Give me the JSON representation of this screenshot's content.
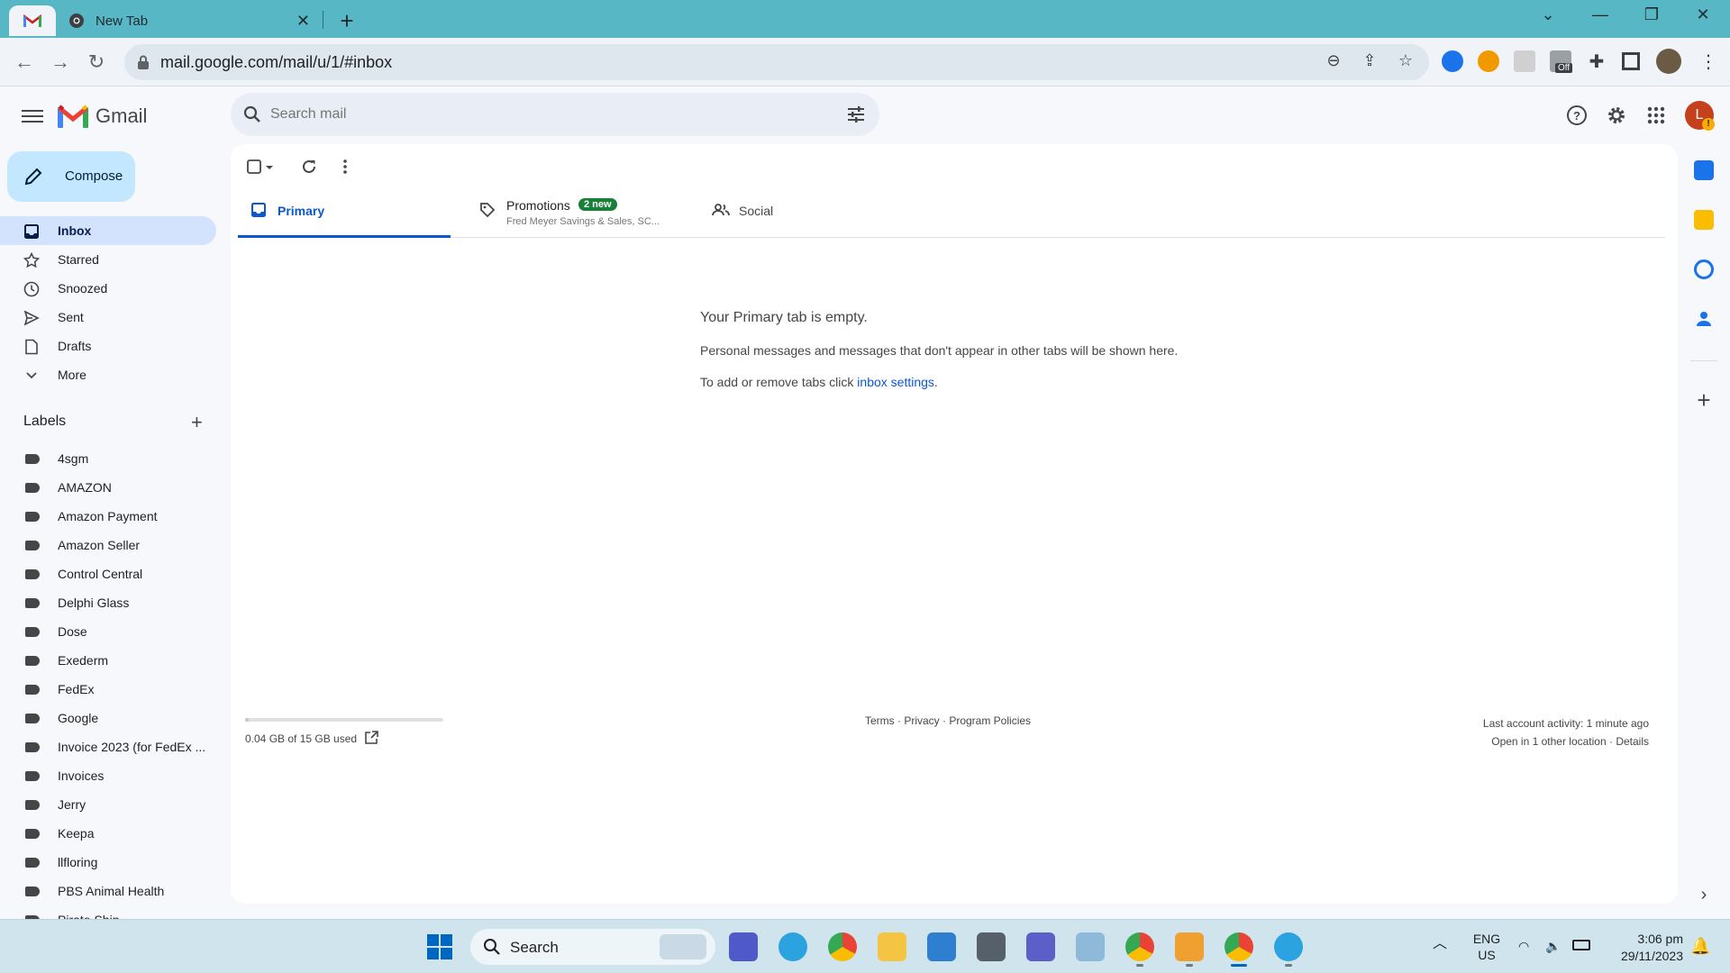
{
  "browser": {
    "tab_title": "New Tab",
    "url": "mail.google.com/mail/u/1/#inbox",
    "extension_badge": "Off"
  },
  "gmail": {
    "app_name": "Gmail",
    "search_placeholder": "Search mail",
    "avatar_letter": "L",
    "avatar_badge": "!"
  },
  "compose_label": "Compose",
  "nav": [
    {
      "label": "Inbox",
      "icon": "inbox-icon",
      "active": true
    },
    {
      "label": "Starred",
      "icon": "star-icon"
    },
    {
      "label": "Snoozed",
      "icon": "clock-icon"
    },
    {
      "label": "Sent",
      "icon": "send-icon"
    },
    {
      "label": "Drafts",
      "icon": "draft-icon"
    },
    {
      "label": "More",
      "icon": "chevron-down-icon"
    }
  ],
  "labels_heading": "Labels",
  "labels": [
    "4sgm",
    "AMAZON",
    "Amazon Payment",
    "Amazon Seller",
    "Control Central",
    "Delphi Glass",
    "Dose",
    "Exederm",
    "FedEx",
    "Google",
    "Invoice 2023 (for FedEx ...",
    "Invoices",
    "Jerry",
    "Keepa",
    "llfloring",
    "PBS Animal Health",
    "Pirate Ship"
  ],
  "tabs": {
    "primary": "Primary",
    "promotions": "Promotions",
    "promotions_badge": "2 new",
    "promotions_sub": "Fred Meyer Savings & Sales, SC...",
    "social": "Social"
  },
  "empty": {
    "title": "Your Primary tab is empty.",
    "message": "Personal messages and messages that don't appear in other tabs will be shown here.",
    "hint_prefix": "To add or remove tabs click ",
    "hint_link": "inbox settings",
    "hint_suffix": "."
  },
  "footer": {
    "storage": "0.04 GB of 15 GB used",
    "storage_fraction": 0.003,
    "links": "Terms · Privacy · Program Policies",
    "activity": "Last account activity: 1 minute ago",
    "activity_detail": "Open in 1 other location · Details"
  },
  "taskbar": {
    "search_label": "Search",
    "lang": "ENG",
    "region": "US",
    "time": "3:06 pm",
    "date": "29/11/2023"
  },
  "colors": {
    "accent": "#0b57d0",
    "compose_bg": "#c2e7ff",
    "nav_active_bg": "#d3e3fd",
    "promotions_badge": "#188038",
    "chrome_frame": "#57b7c4",
    "avatar": "#c5411c"
  }
}
